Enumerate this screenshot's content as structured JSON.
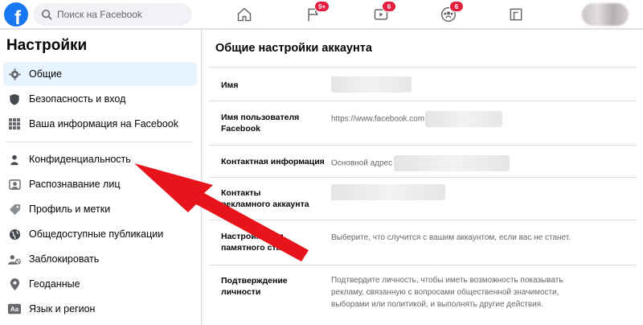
{
  "topbar": {
    "logo_letter": "f",
    "search_placeholder": "Поиск на Facebook",
    "nav": [
      {
        "icon": "home-icon",
        "badge": ""
      },
      {
        "icon": "flag-icon",
        "badge": "9+"
      },
      {
        "icon": "watch-icon",
        "badge": "6"
      },
      {
        "icon": "groups-icon",
        "badge": "6"
      },
      {
        "icon": "gaming-icon",
        "badge": ""
      }
    ]
  },
  "sidebar": {
    "title": "Настройки",
    "items": [
      {
        "label": "Общие",
        "icon": "gear-icon",
        "active": true
      },
      {
        "label": "Безопасность и вход",
        "icon": "shield-icon",
        "active": false
      },
      {
        "label": "Ваша информация на Facebook",
        "icon": "info-grid-icon",
        "active": false
      },
      {
        "label": "Конфиденциальность",
        "icon": "lock-person-icon",
        "active": false
      },
      {
        "label": "Распознавание лиц",
        "icon": "face-icon",
        "active": false
      },
      {
        "label": "Профиль и метки",
        "icon": "tag-icon",
        "active": false
      },
      {
        "label": "Общедоступные публикации",
        "icon": "globe-icon",
        "active": false
      },
      {
        "label": "Заблокировать",
        "icon": "block-user-icon",
        "active": false
      },
      {
        "label": "Геоданные",
        "icon": "location-icon",
        "active": false
      },
      {
        "label": "Язык и регион",
        "icon": "language-icon",
        "active": false
      }
    ]
  },
  "main": {
    "title": "Общие настройки аккаунта",
    "rows": [
      {
        "label": "Имя",
        "value": ""
      },
      {
        "label": "Имя пользователя Facebook",
        "value": "https://www.facebook.com"
      },
      {
        "label": "Контактная информация",
        "value": "Основной адрес"
      },
      {
        "label": "Контакты рекламного аккаунта",
        "value": ""
      },
      {
        "label": "Настройки для памятного статуса",
        "value": "Выберите, что случится с вашим аккаунтом, если вас не станет."
      },
      {
        "label": "Подтверждение личности",
        "value": "Подтвердите личность, чтобы иметь возможность показывать рекламу, связанную с вопросами общественной значимости, выборами или политикой, и выполнять другие действия."
      }
    ]
  },
  "colors": {
    "brand": "#1877f2",
    "badge": "#e41e3f",
    "active_bg": "#e7f3ff",
    "annotation_arrow": "#e8141b"
  }
}
